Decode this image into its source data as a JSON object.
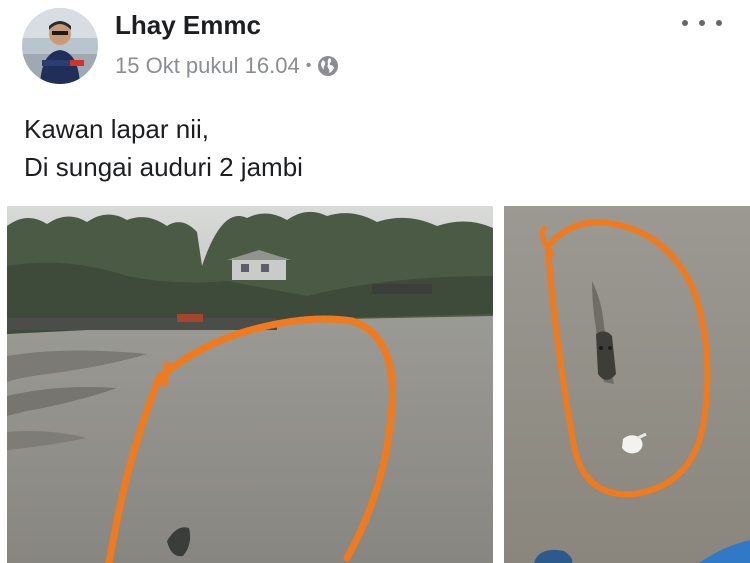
{
  "post": {
    "author": "Lhay Emmc",
    "timestamp": "15 Okt pukul 16.04",
    "separator": "•",
    "privacy_icon": "globe-icon",
    "more_icon": "more-options-icon",
    "text_line1": "Kawan lapar nii,",
    "text_line2": "Di sungai auduri 2 jambi"
  },
  "photos": [
    {
      "subject": "river-photo-with-orange-circle"
    },
    {
      "subject": "crocodile-in-water-photo-with-orange-circle"
    }
  ],
  "colors": {
    "annotation_orange": "#f07a1e",
    "water": "#8d8b86",
    "text": "#1c1e21",
    "meta": "#8a8d91"
  }
}
